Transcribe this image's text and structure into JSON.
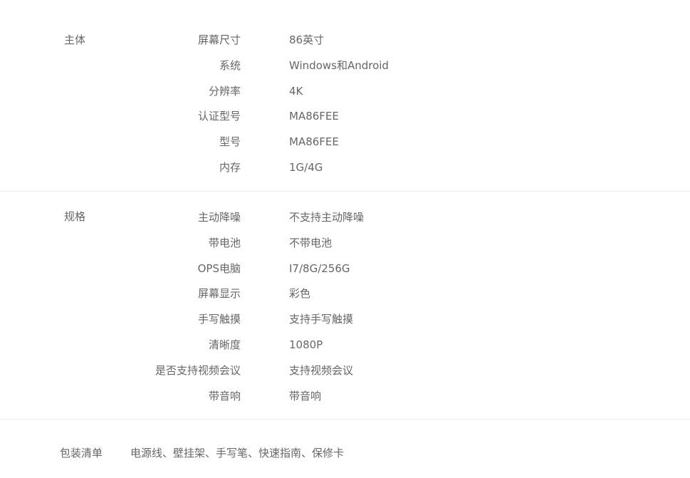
{
  "main": {
    "title": "主体",
    "rows": [
      {
        "label": "屏幕尺寸",
        "value": "86英寸"
      },
      {
        "label": "系统",
        "value": "Windows和Android"
      },
      {
        "label": "分辨率",
        "value": "4K"
      },
      {
        "label": "认证型号",
        "value": "MA86FEE"
      },
      {
        "label": "型号",
        "value": "MA86FEE"
      },
      {
        "label": "内存",
        "value": "1G/4G"
      }
    ]
  },
  "spec": {
    "title": "规格",
    "rows": [
      {
        "label": "主动降噪",
        "value": "不支持主动降噪"
      },
      {
        "label": "带电池",
        "value": "不带电池"
      },
      {
        "label": "OPS电脑",
        "value": "I7/8G/256G"
      },
      {
        "label": "屏幕显示",
        "value": "彩色"
      },
      {
        "label": "手写触摸",
        "value": "支持手写触摸"
      },
      {
        "label": "清晰度",
        "value": "1080P"
      },
      {
        "label": "是否支持视频会议",
        "value": "支持视频会议"
      },
      {
        "label": "带音响",
        "value": "带音响"
      }
    ]
  },
  "package": {
    "label": "包装清单",
    "value": "电源线、壁挂架、手写笔、快速指南、保修卡"
  }
}
